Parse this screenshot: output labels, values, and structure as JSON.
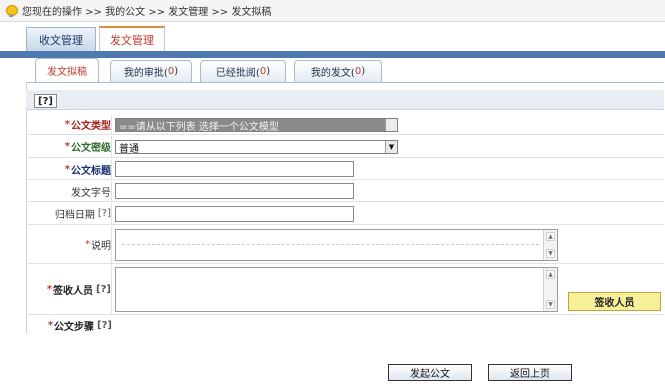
{
  "breadcrumb": {
    "icon": "lightbulb-icon",
    "text": "您现在的操作 >> 我的公文 >> 发文管理 >> 发文拟稿"
  },
  "main_tabs": [
    {
      "label": "收文管理",
      "active": false
    },
    {
      "label": "发文管理",
      "active": true
    }
  ],
  "sub_tabs": [
    {
      "label": "发文拟稿",
      "count": "",
      "active": true
    },
    {
      "label": "我的审批(",
      "count": "0",
      "suffix": ")",
      "active": false
    },
    {
      "label": "已经批阅(",
      "count": "0",
      "suffix": ")",
      "active": false
    },
    {
      "label": "我的发文(",
      "count": "0",
      "suffix": ")",
      "active": false
    }
  ],
  "help_button": "[?]",
  "form": {
    "doc_type": {
      "star": "*",
      "label": "公文类型",
      "value": "==请从以下列表 选择一个公文模型"
    },
    "secret_level": {
      "star": "*",
      "label": "公文密级",
      "value": "普通"
    },
    "title": {
      "star": "*",
      "label": "公文标题",
      "value": ""
    },
    "doc_number": {
      "label": "发文字号",
      "value": ""
    },
    "archive_date": {
      "label": "归档日期",
      "help": "[?]",
      "value": ""
    },
    "remark": {
      "star": "*",
      "label": "说明",
      "value": ""
    },
    "recipients": {
      "star": "*",
      "label": "签收人员",
      "help": "[?]",
      "value": ""
    },
    "steps": {
      "star": "*",
      "label": "公文步骤",
      "help": "[?]"
    }
  },
  "buttons": {
    "sign_person": "签收人员",
    "submit": "发起公文",
    "back": "返回上页"
  },
  "colors": {
    "band": "#4e7ab1",
    "active_tab_text": "#c0392b",
    "sign_button": "#f7ef9a"
  }
}
